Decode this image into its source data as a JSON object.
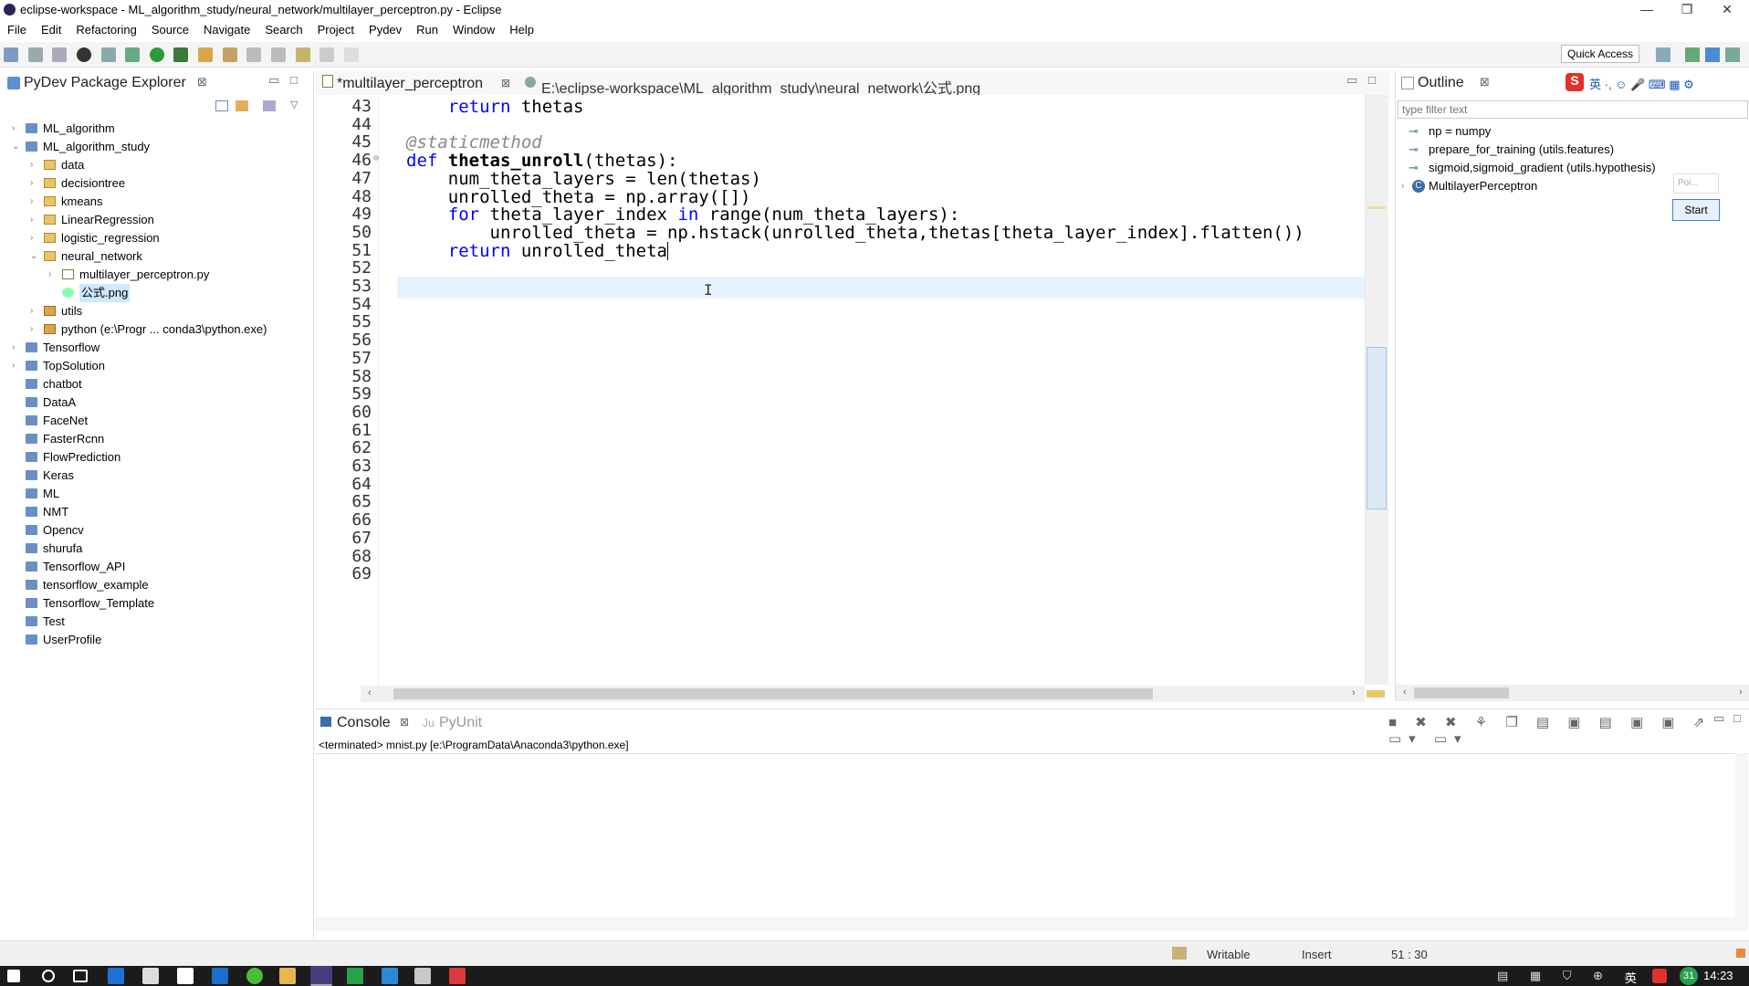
{
  "window": {
    "title": "eclipse-workspace - ML_algorithm_study/neural_network/multilayer_perceptron.py - Eclipse",
    "min_icon": "minimize-icon",
    "max_icon": "restore-icon",
    "close_icon": "close-icon"
  },
  "menu": [
    "File",
    "Edit",
    "Refactoring",
    "Source",
    "Navigate",
    "Search",
    "Project",
    "Pydev",
    "Run",
    "Window",
    "Help"
  ],
  "toolbar": {
    "quick_access": "Quick Access"
  },
  "explorer": {
    "title": "PyDev Package Explorer",
    "items": [
      {
        "label": "ML_algorithm",
        "indent": 0,
        "tw": "›",
        "type": "proj"
      },
      {
        "label": "ML_algorithm_study",
        "indent": 0,
        "tw": "⌄",
        "type": "proj"
      },
      {
        "label": "data",
        "indent": 1,
        "tw": "›",
        "type": "fold"
      },
      {
        "label": "decisiontree",
        "indent": 1,
        "tw": "›",
        "type": "fold"
      },
      {
        "label": "kmeans",
        "indent": 1,
        "tw": "›",
        "type": "fold"
      },
      {
        "label": "LinearRegression",
        "indent": 1,
        "tw": "›",
        "type": "fold"
      },
      {
        "label": "logistic_regression",
        "indent": 1,
        "tw": "›",
        "type": "fold"
      },
      {
        "label": "neural_network",
        "indent": 1,
        "tw": "⌄",
        "type": "fold"
      },
      {
        "label": "multilayer_perceptron.py",
        "indent": 2,
        "tw": "›",
        "type": "pyf"
      },
      {
        "label": "公式.png",
        "indent": 2,
        "tw": "",
        "type": "img",
        "selected": true
      },
      {
        "label": "utils",
        "indent": 1,
        "tw": "›",
        "type": "pkg"
      },
      {
        "label": "python  (e:\\Progr ... conda3\\python.exe)",
        "indent": 1,
        "tw": "›",
        "type": "pkg"
      },
      {
        "label": "Tensorflow",
        "indent": 0,
        "tw": "›",
        "type": "proj"
      },
      {
        "label": "TopSolution",
        "indent": 0,
        "tw": "›",
        "type": "proj"
      },
      {
        "label": "chatbot",
        "indent": 0,
        "tw": "",
        "type": "proj"
      },
      {
        "label": "DataA",
        "indent": 0,
        "tw": "",
        "type": "proj"
      },
      {
        "label": "FaceNet",
        "indent": 0,
        "tw": "",
        "type": "proj"
      },
      {
        "label": "FasterRcnn",
        "indent": 0,
        "tw": "",
        "type": "proj"
      },
      {
        "label": "FlowPrediction",
        "indent": 0,
        "tw": "",
        "type": "proj"
      },
      {
        "label": "Keras",
        "indent": 0,
        "tw": "",
        "type": "proj"
      },
      {
        "label": "ML",
        "indent": 0,
        "tw": "",
        "type": "proj"
      },
      {
        "label": "NMT",
        "indent": 0,
        "tw": "",
        "type": "proj"
      },
      {
        "label": "Opencv",
        "indent": 0,
        "tw": "",
        "type": "proj"
      },
      {
        "label": "shurufa",
        "indent": 0,
        "tw": "",
        "type": "proj"
      },
      {
        "label": "Tensorflow_API",
        "indent": 0,
        "tw": "",
        "type": "proj"
      },
      {
        "label": "tensorflow_example",
        "indent": 0,
        "tw": "",
        "type": "proj"
      },
      {
        "label": "Tensorflow_Template",
        "indent": 0,
        "tw": "",
        "type": "proj"
      },
      {
        "label": "Test",
        "indent": 0,
        "tw": "",
        "type": "proj"
      },
      {
        "label": "UserProfile",
        "indent": 0,
        "tw": "",
        "type": "proj"
      }
    ]
  },
  "editor": {
    "tabs": [
      {
        "label": "*multilayer_perceptron",
        "active": true
      },
      {
        "label": "E:\\eclipse-workspace\\ML_algorithm_study\\neural_network\\公式.png",
        "active": false
      }
    ],
    "lines": [
      {
        "n": "43",
        "html": "    <span class='kw'>return</span> thetas"
      },
      {
        "n": "44",
        "html": ""
      },
      {
        "n": "45",
        "html": "<span class='dec'>@staticmethod</span>"
      },
      {
        "n": "46",
        "html": "<span class='kw'>def</span> <span class='fn'>thetas_unroll</span>(thetas):"
      },
      {
        "n": "47",
        "html": "    num_theta_layers = len(thetas)"
      },
      {
        "n": "48",
        "html": "    unrolled_theta = np.array([])"
      },
      {
        "n": "49",
        "html": "    <span class='kw'>for</span> theta_layer_index <span class='kw'>in</span> range(num_theta_layers):"
      },
      {
        "n": "50",
        "html": "        unrolled_theta = np.hstack(unrolled_theta,thetas[theta_layer_index].flatten())"
      },
      {
        "n": "51",
        "html": "    <span class='kw'>return</span> unrolled_theta<span class='cursor'></span>"
      },
      {
        "n": "52",
        "html": ""
      },
      {
        "n": "53",
        "html": ""
      },
      {
        "n": "54",
        "html": ""
      },
      {
        "n": "55",
        "html": ""
      },
      {
        "n": "56",
        "html": ""
      },
      {
        "n": "57",
        "html": ""
      },
      {
        "n": "58",
        "html": ""
      },
      {
        "n": "59",
        "html": ""
      },
      {
        "n": "60",
        "html": ""
      },
      {
        "n": "61",
        "html": ""
      },
      {
        "n": "62",
        "html": ""
      },
      {
        "n": "63",
        "html": ""
      },
      {
        "n": "64",
        "html": ""
      },
      {
        "n": "65",
        "html": ""
      },
      {
        "n": "66",
        "html": ""
      },
      {
        "n": "67",
        "html": ""
      },
      {
        "n": "68",
        "html": ""
      },
      {
        "n": "69",
        "html": ""
      }
    ]
  },
  "outline": {
    "title": "Outline",
    "filter_placeholder": "type filter text",
    "items": [
      {
        "label": "np = numpy"
      },
      {
        "label": "prepare_for_training (utils.features)"
      },
      {
        "label": "sigmoid,sigmoid_gradient (utils.hypothesis)"
      },
      {
        "label": "MultilayerPerceptron"
      }
    ],
    "popup_label": "Poi...",
    "start_button": "Start"
  },
  "console": {
    "tab_console": "Console",
    "tab_pyunit": "PyUnit",
    "status_line": "<terminated> mnist.py [e:\\ProgramData\\Anaconda3\\python.exe]"
  },
  "status": {
    "writable": "Writable",
    "insert": "Insert",
    "position": "51 : 30"
  },
  "taskbar": {
    "ime": "英",
    "badge": "31",
    "time": "14:23"
  },
  "colors": {
    "keyword": "#0000ff",
    "selection": "#cde8ff",
    "accent": "#3399ff"
  }
}
